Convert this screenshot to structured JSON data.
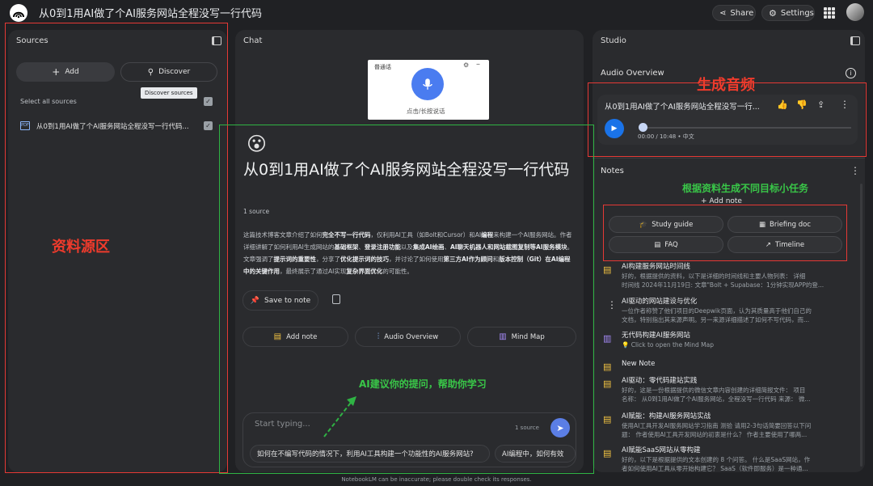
{
  "app": {
    "title": "从0到1用AI做了个AI服务网站全程没写一行代码",
    "share_label": "Share",
    "settings_label": "Settings"
  },
  "sources": {
    "title": "Sources",
    "add_label": "Add",
    "discover_label": "Discover",
    "discover_tooltip": "Discover sources",
    "select_all_label": "Select all sources",
    "items": [
      {
        "label": "从0到1用AI做了个AI服务网站全程没写一行代码..."
      }
    ]
  },
  "chat": {
    "title": "Chat",
    "voice_widget": {
      "tab_label": "普通话",
      "hint": "点击/长按说话"
    },
    "emoji": "😮",
    "doc_title": "从0到1用AI做了个AI服务网站全程没写一行代码",
    "source_count": "1 source",
    "summary_parts": [
      {
        "text": "这篇技术博客文章介绍了如何",
        "b": false
      },
      {
        "text": "完全不写一行代码",
        "b": true
      },
      {
        "text": "，仅利用AI工具（如Bolt和Cursor）和AI",
        "b": false
      },
      {
        "text": "编程",
        "b": true
      },
      {
        "text": "来构建一个AI服务网站。作者详细讲解了如何利用AI生成网站的",
        "b": false
      },
      {
        "text": "基础框架",
        "b": true
      },
      {
        "text": "、",
        "b": false
      },
      {
        "text": "登录注册功能",
        "b": true
      },
      {
        "text": "以及",
        "b": false
      },
      {
        "text": "集成AI绘画",
        "b": true
      },
      {
        "text": "、",
        "b": false
      },
      {
        "text": "AI聊天机器人和网站截图复制等AI服务模块",
        "b": true
      },
      {
        "text": "。文章强调了",
        "b": false
      },
      {
        "text": "提示词的重要性",
        "b": true
      },
      {
        "text": "，分享了",
        "b": false
      },
      {
        "text": "优化提示词的技巧",
        "b": true
      },
      {
        "text": "，并讨论了如何使用",
        "b": false
      },
      {
        "text": "第三方AI作为顾问",
        "b": true
      },
      {
        "text": "和",
        "b": false
      },
      {
        "text": "版本控制（Git）在AI编程中的关键作用",
        "b": true
      },
      {
        "text": "，最终展示了通过AI实现",
        "b": false
      },
      {
        "text": "复杂界面优化",
        "b": true
      },
      {
        "text": "的可能性。",
        "b": false
      }
    ],
    "save_to_note_label": "Save to note",
    "add_note_label": "Add note",
    "audio_overview_label": "Audio Overview",
    "mind_map_label": "Mind Map",
    "input_placeholder": "Start typing...",
    "input_source_count": "1 source",
    "suggestions": [
      "如何在不编写代码的情况下，利用AI工具构建一个功能性的AI服务网站?",
      "AI编程中，如何有效"
    ],
    "footer": "NotebookLM can be inaccurate; please double check its responses."
  },
  "studio": {
    "title": "Studio",
    "audio_overview_title": "Audio Overview",
    "audio_title": "从0到1用AI做了个AI服务网站全程没写一行...",
    "audio_time": "00:00 / 10:48 • 中文",
    "audio_progress": 0.0,
    "notes_title": "Notes",
    "add_note_label": "Add note",
    "study_guide_label": "Study guide",
    "briefing_doc_label": "Briefing doc",
    "faq_label": "FAQ",
    "timeline_label": "Timeline",
    "notes": [
      {
        "title": "AI构建服务网站时间线",
        "body1": "好的，根据提供的资料，以下是详细的时间线和主要人物列表： 详细",
        "body2": "时间线 2024年11月19日: 文章\"Bolt + Supabase：1分钟实现APP的登...",
        "icon": "doc-icon"
      },
      {
        "title": "AI驱动的网站建设与优化",
        "body1": "一位作者称赞了他们项目的Deepwik页面，认为其质量高于他们自己的",
        "body2": "文档，特别指出其来源声明。另一来源详细描述了如何不写代码，而...",
        "icon": "more-vert-icon"
      },
      {
        "title": "无代码构建AI服务网站",
        "body1": "💡 Click to open the Mind Map",
        "body2": "",
        "icon": "mind-map-icon"
      },
      {
        "title": "New Note",
        "body1": "",
        "body2": "",
        "icon": "doc-icon"
      },
      {
        "title": "AI驱动：零代码建站实践",
        "body1": "好的，这是一份根据提供的微信文章内容创建的详细简报文件： 项目",
        "body2": "名称： 从0到1用AI做了个AI服务网站，全程没写一行代码 来源： 微...",
        "icon": "doc-icon"
      },
      {
        "title": "AI赋能：构建AI服务网站实战",
        "body1": "使用AI工具开发AI服务网站学习指南 测验 请用2-3句话简要回答以下问",
        "body2": "题： 作者使用AI工具开发网站的初衷是什么？ 作者主要使用了哪两...",
        "icon": "doc-icon"
      },
      {
        "title": "AI赋能SaaS网站从零构建",
        "body1": "好的，以下是根据提供的文本创建的 8 个问答。 什么是SaaS网站，作",
        "body2": "者如何使用AI工具从零开始构建它？ SaaS（软件即服务）是一种通...",
        "icon": "doc-icon"
      }
    ]
  },
  "annotations": {
    "sources_area": "资料源区",
    "audio_gen": "生成音频",
    "tasks": "根据资料生成不同目标小任务",
    "suggest": "AI建议你的提问，帮助你学习"
  },
  "colors": {
    "accent_blue": "#1a73e8",
    "note_yellow": "#f4c542",
    "mindmap_purple": "#a78bfa",
    "red_box": "#e53935",
    "green_box": "#2fb344"
  }
}
